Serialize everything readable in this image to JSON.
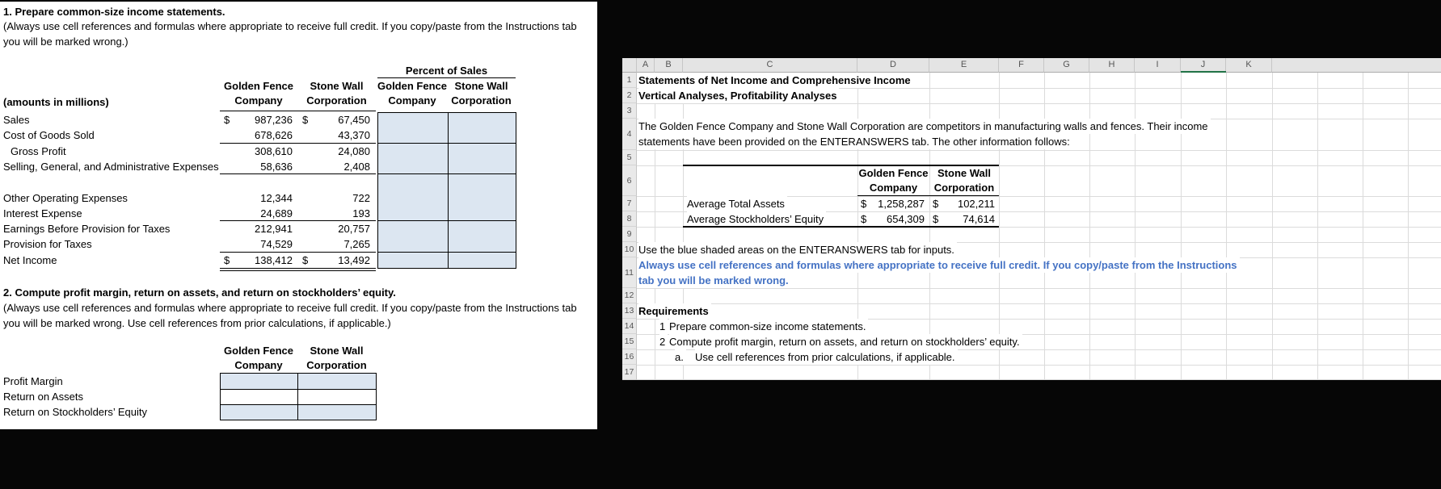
{
  "colors": {
    "input_fill": "#DCE6F1",
    "accent_blue_text": "#4472C4",
    "selection_green": "#217346"
  },
  "left_sheet": {
    "section1": {
      "title": "1. Prepare common-size income statements.",
      "note_lines": [
        "(Always use cell references and formulas where appropriate to receive full credit. If you copy/paste from the Instructions tab",
        "you will be marked wrong.)"
      ],
      "percent_header": "Percent of Sales",
      "columns": [
        {
          "line1": "Golden Fence",
          "line2": "Company"
        },
        {
          "line1": "Stone Wall",
          "line2": "Corporation"
        },
        {
          "line1": "Golden Fence",
          "line2": "Company"
        },
        {
          "line1": "Stone Wall",
          "line2": "Corporation"
        }
      ],
      "row_label_header": "(amounts in millions)",
      "rows": [
        {
          "label": "Sales",
          "gf_dollar": "$",
          "gf": "987,236",
          "sw_dollar": "$",
          "sw": "67,450"
        },
        {
          "label": "Cost of Goods Sold",
          "gf_dollar": "",
          "gf": "678,626",
          "sw_dollar": "",
          "sw": "43,370"
        },
        {
          "label": "Gross Profit",
          "gf_dollar": "",
          "gf": "308,610",
          "sw_dollar": "",
          "sw": "24,080"
        },
        {
          "label": "Selling, General, and Administrative Expenses",
          "gf_dollar": "",
          "gf": "58,636",
          "sw_dollar": "",
          "sw": "2,408"
        },
        {
          "label": "",
          "gf_dollar": "",
          "gf": "",
          "sw_dollar": "",
          "sw": ""
        },
        {
          "label": "Other Operating Expenses",
          "gf_dollar": "",
          "gf": "12,344",
          "sw_dollar": "",
          "sw": "722"
        },
        {
          "label": "Interest Expense",
          "gf_dollar": "",
          "gf": "24,689",
          "sw_dollar": "",
          "sw": "193"
        },
        {
          "label": "Earnings Before Provision for Taxes",
          "gf_dollar": "",
          "gf": "212,941",
          "sw_dollar": "",
          "sw": "20,757"
        },
        {
          "label": "Provision for Taxes",
          "gf_dollar": "",
          "gf": "74,529",
          "sw_dollar": "",
          "sw": "7,265"
        },
        {
          "label": "Net Income",
          "gf_dollar": "$",
          "gf": "138,412",
          "sw_dollar": "$",
          "sw": "13,492"
        }
      ]
    },
    "section2": {
      "title": "2. Compute profit margin, return on assets, and return on stockholders’ equity.",
      "note_lines": [
        "(Always use cell references and formulas where appropriate to receive full credit. If you copy/paste from the Instructions tab",
        "you will be marked wrong. Use cell references from prior calculations, if applicable.)"
      ],
      "columns": [
        {
          "line1": "Golden Fence",
          "line2": "Company"
        },
        {
          "line1": "Stone Wall",
          "line2": "Corporation"
        }
      ],
      "rows": [
        {
          "label": "Profit Margin"
        },
        {
          "label": "Return on Assets"
        },
        {
          "label": "Return on Stockholders’ Equity"
        }
      ]
    }
  },
  "right_sheet": {
    "column_headers": [
      "A",
      "B",
      "C",
      "D",
      "E",
      "F",
      "G",
      "H",
      "I",
      "J",
      "K"
    ],
    "row_numbers": [
      "1",
      "2",
      "3",
      "4",
      "5",
      "6",
      "7",
      "8",
      "9",
      "10",
      "11",
      "12",
      "13",
      "14",
      "15",
      "16",
      "17"
    ],
    "title_line1": "Statements of Net Income and Comprehensive Income",
    "title_line2": "Vertical Analyses, Profitability Analyses",
    "intro_lines": [
      "The Golden Fence Company and Stone Wall Corporation are competitors in manufacturing walls and fences. Their income",
      "statements have been provided on the ENTERANSWERS tab. The other information follows:"
    ],
    "info_table": {
      "columns": [
        {
          "line1": "Golden Fence",
          "line2": "Company"
        },
        {
          "line1": "Stone Wall",
          "line2": "Corporation"
        }
      ],
      "rows": [
        {
          "label": "Average Total Assets",
          "gf_dollar": "$",
          "gf": "1,258,287",
          "sw_dollar": "$",
          "sw": "102,211"
        },
        {
          "label": "Average Stockholders’ Equity",
          "gf_dollar": "$",
          "gf": "654,309",
          "sw_dollar": "$",
          "sw": "74,614"
        }
      ]
    },
    "inputs_note": "Use the blue shaded areas on the ENTERANSWERS tab for inputs.",
    "warning_lines": [
      "Always use cell references and formulas where appropriate to receive full credit. If you copy/paste from the Instructions",
      "tab you will be marked wrong."
    ],
    "requirements_title": "Requirements",
    "requirements": [
      {
        "num": "1",
        "text": "Prepare common-size income statements."
      },
      {
        "num": "2",
        "text": "Compute profit margin, return on assets, and return on stockholders’ equity."
      },
      {
        "num": "a.",
        "text": "Use cell references from prior calculations, if applicable."
      }
    ]
  }
}
